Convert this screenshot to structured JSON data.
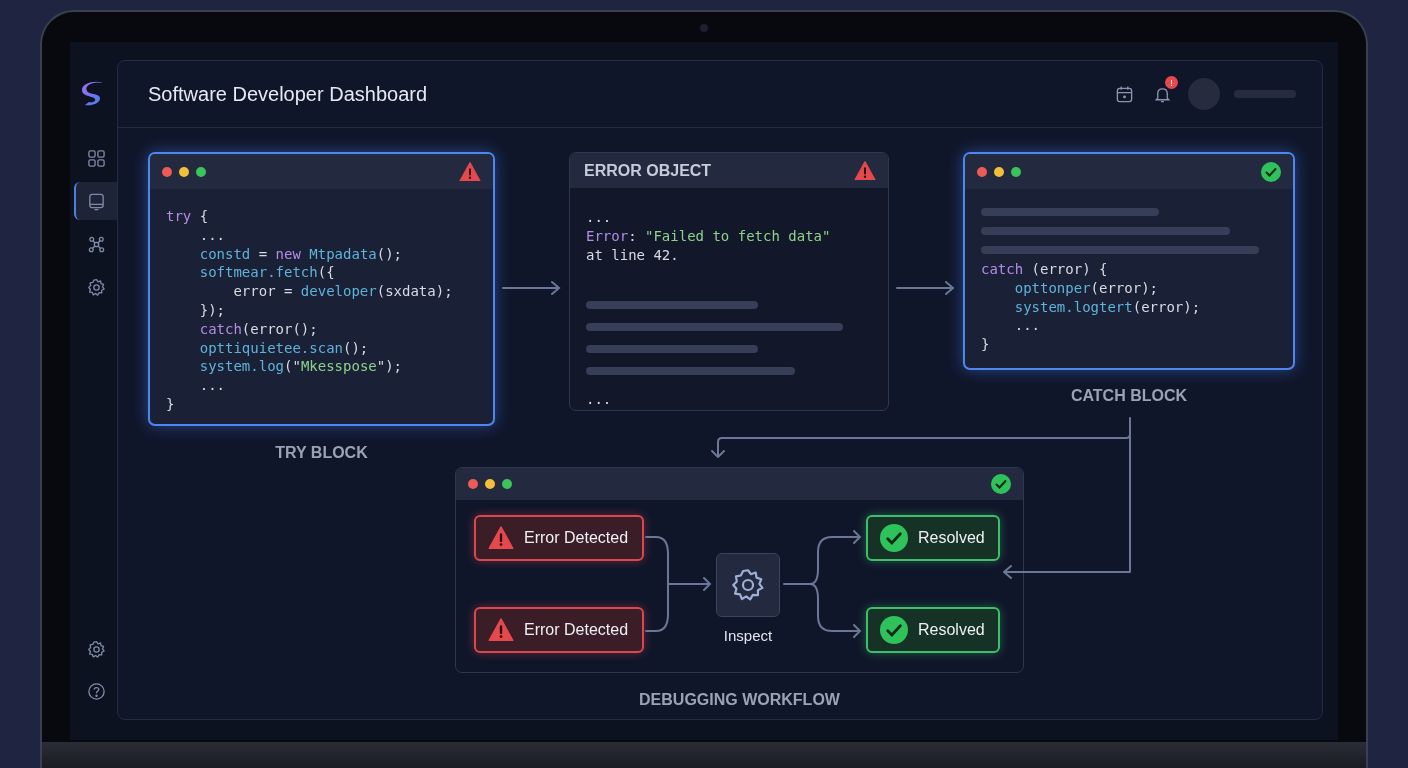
{
  "app": {
    "title": "Software Developer Dashboard"
  },
  "sidebar": {
    "items": [
      {
        "kind": "grid",
        "selected": false
      },
      {
        "kind": "monitor",
        "selected": true
      },
      {
        "kind": "network",
        "selected": false
      },
      {
        "kind": "gear",
        "selected": false
      }
    ],
    "bottom_items": [
      {
        "kind": "gear"
      },
      {
        "kind": "help"
      }
    ]
  },
  "header": {
    "notification_badge": "!"
  },
  "try_card": {
    "badge": {
      "kind": "error"
    },
    "highlighted": true,
    "label": "TRY BLOCK",
    "lines": [
      {
        "tokens": [
          {
            "kind": "keyword",
            "text": "try"
          },
          {
            "kind": "plain",
            "text": " {"
          }
        ]
      },
      {
        "tokens": [
          {
            "kind": "plain",
            "text": "    ..."
          }
        ]
      },
      {
        "tokens": [
          {
            "kind": "fn",
            "text": "    constd"
          },
          {
            "kind": "plain",
            "text": " = "
          },
          {
            "kind": "keyword",
            "text": "new"
          },
          {
            "kind": "fn",
            "text": " Mtpadata"
          },
          {
            "kind": "plain",
            "text": "();"
          }
        ]
      },
      {
        "tokens": [
          {
            "kind": "fn",
            "text": "    softmear.fetch"
          },
          {
            "kind": "plain",
            "text": "({"
          }
        ]
      },
      {
        "tokens": [
          {
            "kind": "plain",
            "text": "        error = "
          },
          {
            "kind": "fn",
            "text": "developer"
          },
          {
            "kind": "plain",
            "text": "(sxdata);"
          }
        ]
      },
      {
        "tokens": [
          {
            "kind": "plain",
            "text": "    });"
          }
        ]
      },
      {
        "tokens": [
          {
            "kind": "keyword",
            "text": "    catch"
          },
          {
            "kind": "plain",
            "text": "(error();"
          }
        ]
      },
      {
        "tokens": [
          {
            "kind": "fn",
            "text": "    opttiquietee.scan"
          },
          {
            "kind": "plain",
            "text": "();"
          }
        ]
      },
      {
        "tokens": [
          {
            "kind": "fn",
            "text": "    system.log"
          },
          {
            "kind": "plain",
            "text": "(\""
          },
          {
            "kind": "string",
            "text": "Mkesspose"
          },
          {
            "kind": "plain",
            "text": "\");"
          }
        ]
      },
      {
        "tokens": [
          {
            "kind": "plain",
            "text": "    ..."
          }
        ]
      },
      {
        "tokens": [
          {
            "kind": "plain",
            "text": "}"
          }
        ]
      }
    ]
  },
  "error_card": {
    "title": "ERROR OBJECT",
    "badge": {
      "kind": "error"
    },
    "highlighted": false,
    "lines": [
      {
        "tokens": [
          {
            "kind": "plain",
            "text": "..."
          }
        ]
      },
      {
        "tokens": [
          {
            "kind": "keyword",
            "text": "Error"
          },
          {
            "kind": "plain",
            "text": ": "
          },
          {
            "kind": "string",
            "text": "\"Failed to fetch data\""
          }
        ]
      },
      {
        "tokens": [
          {
            "kind": "plain",
            "text": "at line 42."
          }
        ]
      }
    ],
    "footer": "..."
  },
  "catch_card": {
    "badge": {
      "kind": "success"
    },
    "highlighted": true,
    "label": "CATCH BLOCK",
    "lines": [
      {
        "tokens": [
          {
            "kind": "keyword",
            "text": "catch"
          },
          {
            "kind": "plain",
            "text": " (error) {"
          }
        ]
      },
      {
        "tokens": [
          {
            "kind": "fn",
            "text": "    opttonper"
          },
          {
            "kind": "plain",
            "text": "(error);"
          }
        ]
      },
      {
        "tokens": [
          {
            "kind": "fn",
            "text": "    system.logtert"
          },
          {
            "kind": "plain",
            "text": "(error);"
          }
        ]
      },
      {
        "tokens": [
          {
            "kind": "plain",
            "text": "    ..."
          }
        ]
      },
      {
        "tokens": [
          {
            "kind": "plain",
            "text": "}"
          }
        ]
      }
    ]
  },
  "workflow": {
    "badge": {
      "kind": "success"
    },
    "label": "DEBUGGING WORKFLOW",
    "errors": [
      {
        "kind": "error",
        "text": "Error Detected"
      },
      {
        "kind": "error",
        "text": "Error Detected"
      }
    ],
    "inspect": {
      "label": "Inspect"
    },
    "results": [
      {
        "kind": "success",
        "text": "Resolved"
      },
      {
        "kind": "success",
        "text": "Resolved"
      }
    ]
  }
}
